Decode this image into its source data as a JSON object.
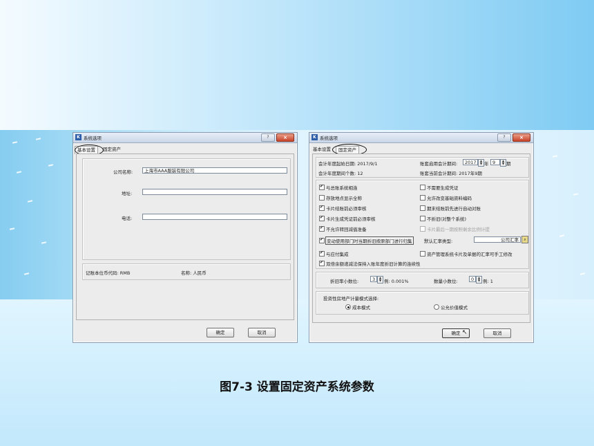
{
  "caption": "图7-3  设置固定资产系统参数",
  "left_window": {
    "title": "系统选项",
    "tabs": [
      "基本设置",
      "固定资产"
    ],
    "company_label": "公司名称:",
    "company_value": "上海市AAA服装有限公司",
    "address_label": "地址:",
    "address_value": "",
    "phone_label": "电话:",
    "phone_value": "",
    "currency_code_label": "记账本位币代码: RMB",
    "currency_name_label": "名称: 人民币",
    "ok": "确定",
    "cancel": "取消"
  },
  "right_window": {
    "title": "系统选项",
    "tabs": [
      "基本设置",
      "固定资产"
    ],
    "fy_start_label": "会计年度起始日期: 2017/9/1",
    "period_count_label": "会计年度期间个数: 12",
    "enable_period_label": "账套启用会计期间:",
    "year_value": "2017",
    "year_unit": "年",
    "month_value": "9",
    "month_unit": "期",
    "current_period_label": "账套当前会计期间: 2017年9期",
    "options_left": [
      {
        "label": "与总账系统相连",
        "checked": true
      },
      {
        "label": "存放地点显示全称",
        "checked": false
      },
      {
        "label": "卡片结账前必须审核",
        "checked": true
      },
      {
        "label": "卡片生成凭证前必须审核",
        "checked": true
      },
      {
        "label": "不允许转回减值准备",
        "checked": true
      }
    ],
    "options_right": [
      {
        "label": "不需要生成凭证",
        "checked": false,
        "disabled": false
      },
      {
        "label": "允许改变基础资料编码",
        "checked": false,
        "disabled": false
      },
      {
        "label": "期末结账前先进行自动对账",
        "checked": false,
        "disabled": false
      },
      {
        "label": "不折旧(对整个系统)",
        "checked": false,
        "disabled": false
      },
      {
        "label": "卡片最后一期按照剩余比例计提",
        "checked": false,
        "disabled": true
      }
    ],
    "dept_change_label": "变动使用部门时当期折旧按原部门进行归集",
    "dept_change_checked": true,
    "rate_type_label": "默认汇率类型:",
    "rate_type_value": "公司汇率",
    "ar_link_label": "与应付集成",
    "ar_link_checked": true,
    "asset_mgmt_label": "资产管理系统卡片及单据的汇率可手工修改",
    "asset_mgmt_checked": false,
    "double_decl_label": "双倍余额递减法保持入账年度折旧计算的连续性",
    "double_decl_checked": true,
    "dep_decimal_label": "折旧率小数位:",
    "dep_decimal_value": "3",
    "dep_example": "例: 0.001%",
    "qty_decimal_label": "数量小数位:",
    "qty_decimal_value": "0",
    "qty_example": "例: 1",
    "invest_label": "投资性房地产计量模式选择:",
    "radio_cost": "成本模式",
    "radio_fair": "公允价值模式",
    "ok": "确定",
    "cancel": "取消"
  }
}
